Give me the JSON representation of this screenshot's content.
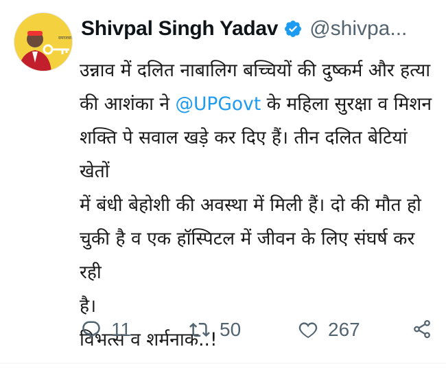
{
  "tweet": {
    "display_name": "Shivpal Singh Yadav",
    "handle": "@shivpa",
    "handle_ellipsis": "...",
    "verified_icon": "verified-badge-icon",
    "avatar_icon": "profile-avatar",
    "body_lines": [
      "उन्नाव में दलित नाबालिग बच्चियों की दुष्कर्म और हत्या",
      "की आशंका ने ",
      "@UPGovt",
      " के महिला सुरक्षा व मिशन",
      "शक्ति पे सवाल खड़े कर दिए हैं। तीन दलित बेटियां खेतों",
      "में बंधी बेहोशी की अवस्था में मिली हैं। दो की मौत हो",
      "चुकी है व एक हॉस्पिटल में जीवन के लिए संघर्ष कर रही",
      "है।",
      "विभत्स व शर्मनाक..!"
    ],
    "colors": {
      "link": "#1d9bf0",
      "muted": "#536471",
      "verified": "#1d9bf0",
      "avatar_bg": "#f4d23f"
    }
  },
  "actions": {
    "reply": {
      "icon": "reply-icon",
      "count": "11"
    },
    "retweet": {
      "icon": "retweet-icon",
      "count": "50"
    },
    "like": {
      "icon": "heart-icon",
      "count": "267"
    },
    "share": {
      "icon": "share-icon"
    }
  }
}
